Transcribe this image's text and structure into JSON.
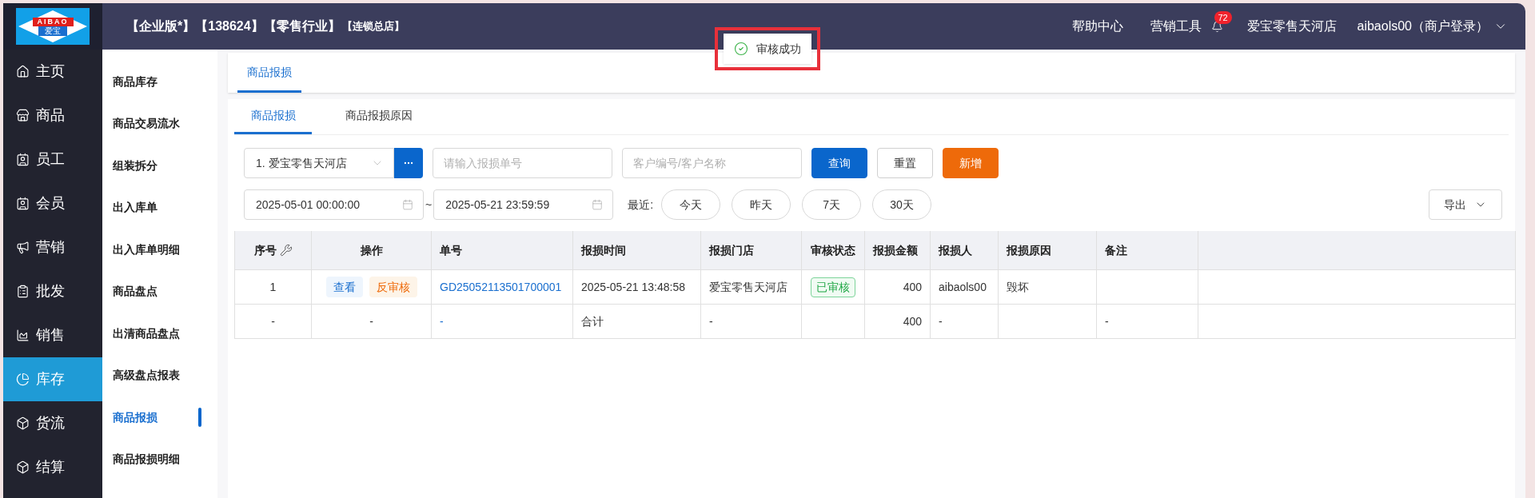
{
  "header": {
    "logo": {
      "brand": "AIBAO",
      "name": "爱宝"
    },
    "title_parts": [
      "【企业版*】",
      "【138624】",
      "【零售行业】"
    ],
    "title_small": "【连锁总店】",
    "links": [
      "帮助中心",
      "营销工具"
    ],
    "notification_count": "72",
    "store": "爱宝零售天河店",
    "user": "aibaols00（商户登录）"
  },
  "toast": {
    "message": "审核成功",
    "highlighted": true
  },
  "sidebar": {
    "items": [
      {
        "label": "主页",
        "selected": false
      },
      {
        "label": "商品",
        "selected": false
      },
      {
        "label": "员工",
        "selected": false
      },
      {
        "label": "会员",
        "selected": false
      },
      {
        "label": "营销",
        "selected": false
      },
      {
        "label": "批发",
        "selected": false
      },
      {
        "label": "销售",
        "selected": false
      },
      {
        "label": "库存",
        "selected": true
      },
      {
        "label": "货流",
        "selected": false
      },
      {
        "label": "结算",
        "selected": false
      }
    ]
  },
  "subnav": {
    "items": [
      {
        "label": "商品库存",
        "selected": false
      },
      {
        "label": "商品交易流水",
        "selected": false
      },
      {
        "label": "组装拆分",
        "selected": false
      },
      {
        "label": "出入库单",
        "selected": false
      },
      {
        "label": "出入库单明细",
        "selected": false
      },
      {
        "label": "商品盘点",
        "selected": false
      },
      {
        "label": "出清商品盘点",
        "selected": false
      },
      {
        "label": "高级盘点报表",
        "selected": false
      },
      {
        "label": "商品报损",
        "selected": true
      },
      {
        "label": "商品报损明细",
        "selected": false
      }
    ]
  },
  "page_tabs": [
    {
      "label": "商品报损",
      "selected": true
    }
  ],
  "tabs": [
    {
      "label": "商品报损",
      "selected": true
    },
    {
      "label": "商品报损原因",
      "selected": false
    }
  ],
  "filters": {
    "store": "1. 爱宝零售天河店",
    "order_placeholder": "请输入报损单号",
    "customer_placeholder": "客户编号/客户名称",
    "buttons": [
      {
        "label": "查询",
        "kind": "primary"
      },
      {
        "label": "重置",
        "kind": "default"
      },
      {
        "label": "新增",
        "kind": "warning"
      }
    ],
    "date_from": "2025-05-01 00:00:00",
    "date_separator": "~",
    "date_to": "2025-05-21 23:59:59",
    "recent_label": "最近:",
    "quick_dates": [
      "今天",
      "昨天",
      "7天",
      "30天"
    ],
    "export": "导出"
  },
  "table": {
    "columns": [
      "序号",
      "操作",
      "单号",
      "报损时间",
      "报损门店",
      "审核状态",
      "报损金额",
      "报损人",
      "报损原因",
      "备注"
    ],
    "rows": [
      {
        "cells": [
          {
            "kind": "text",
            "text": "1"
          },
          {
            "kind": "actions",
            "buttons": [
              {
                "label": "查看",
                "kind": "view"
              },
              {
                "label": "反审核",
                "kind": "unaudit"
              }
            ]
          },
          {
            "kind": "link",
            "text": "GD25052113501700001"
          },
          {
            "kind": "text",
            "text": "2025-05-21 13:48:58"
          },
          {
            "kind": "text",
            "text": "爱宝零售天河店"
          },
          {
            "kind": "tag",
            "text": "已审核"
          },
          {
            "kind": "text",
            "text": "400"
          },
          {
            "kind": "text",
            "text": "aibaols00"
          },
          {
            "kind": "text",
            "text": "毁坏"
          },
          {
            "kind": "empty"
          }
        ]
      },
      {
        "cells": [
          {
            "kind": "text",
            "text": "-"
          },
          {
            "kind": "text",
            "text": "-"
          },
          {
            "kind": "link",
            "text": "-"
          },
          {
            "kind": "text",
            "text": "合计"
          },
          {
            "kind": "text",
            "text": "-"
          },
          {
            "kind": "empty"
          },
          {
            "kind": "text",
            "text": "400"
          },
          {
            "kind": "text",
            "text": "-"
          },
          {
            "kind": "empty"
          },
          {
            "kind": "text",
            "text": "-"
          }
        ]
      }
    ]
  }
}
